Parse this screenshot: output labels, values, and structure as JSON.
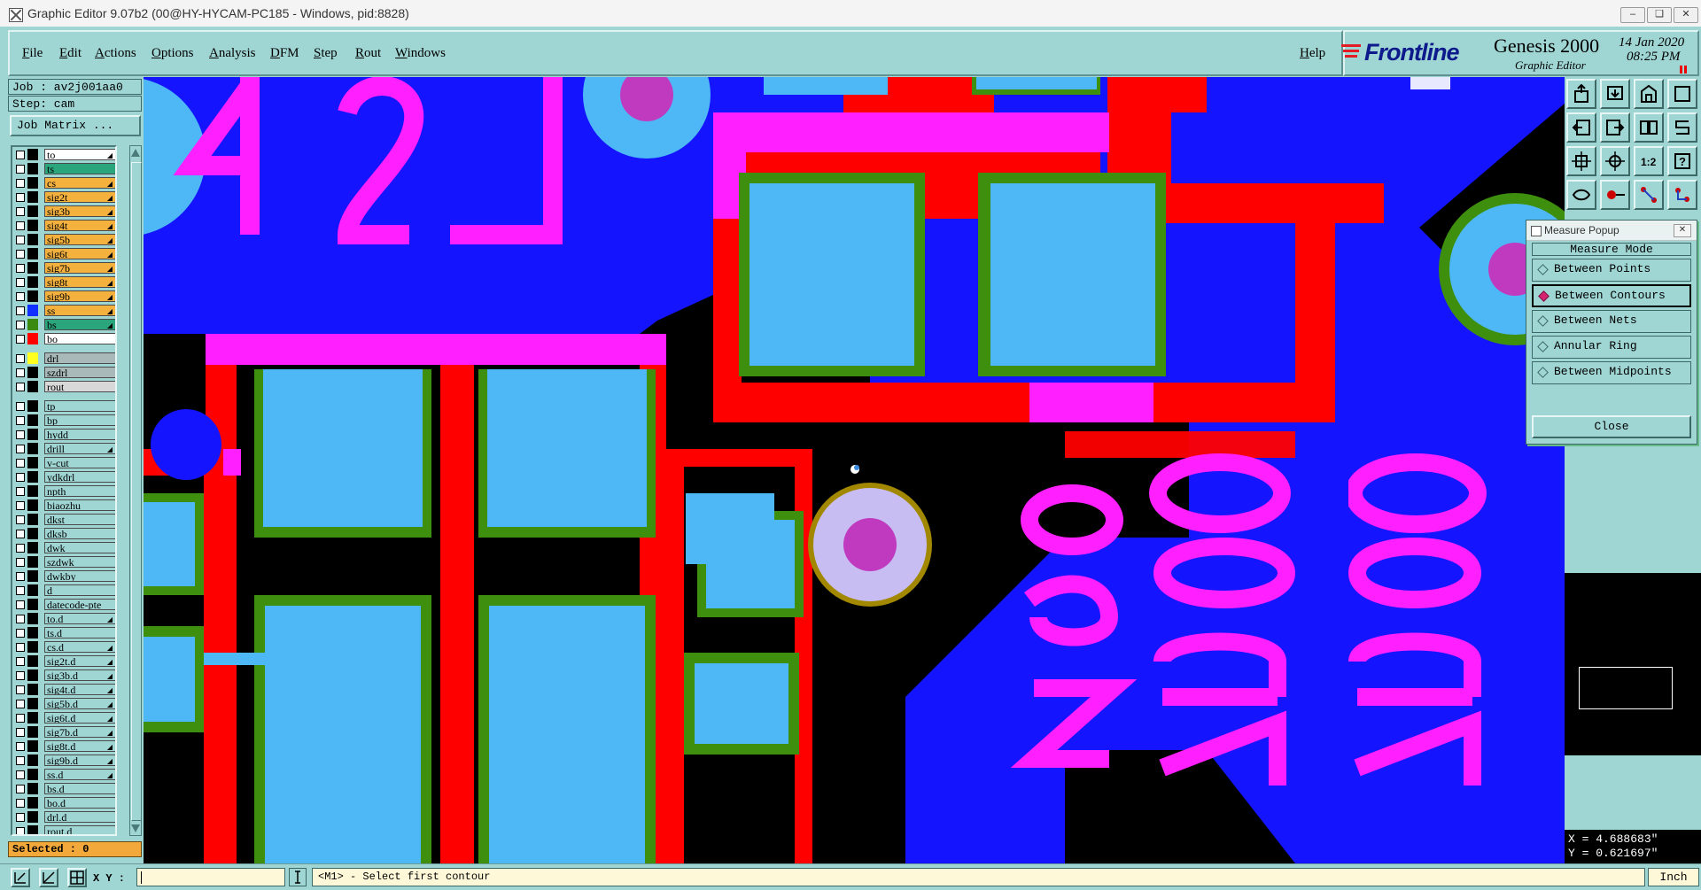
{
  "window": {
    "title": "Graphic Editor 9.07b2 (00@HY-HYCAM-PC185 - Windows, pid:8828)"
  },
  "menu": {
    "items": [
      "File",
      "Edit",
      "Actions",
      "Options",
      "Analysis",
      "DFM",
      "Step",
      "Rout",
      "Windows"
    ],
    "help": "Help"
  },
  "brand": {
    "logo_text": "Frontline",
    "product": "Genesis 2000",
    "subtitle": "Graphic Editor",
    "date": "14 Jan 2020",
    "time": "08:25 PM"
  },
  "left": {
    "job": "Job : av2j001aa0",
    "step": "Step: cam",
    "job_matrix": "Job Matrix ...",
    "selected": "Selected : 0"
  },
  "layers": [
    {
      "name": "to",
      "swatch": "#000000",
      "bg": "#ffffff",
      "arrow": true
    },
    {
      "name": "ts",
      "swatch": "#000000",
      "bg": "#2aa57c",
      "arrow": false
    },
    {
      "name": "cs",
      "swatch": "#000000",
      "bg": "#f5b13e",
      "arrow": true
    },
    {
      "name": "sig2t",
      "swatch": "#000000",
      "bg": "#f5b13e",
      "arrow": true
    },
    {
      "name": "sig3b",
      "swatch": "#000000",
      "bg": "#f5b13e",
      "arrow": true
    },
    {
      "name": "sig4t",
      "swatch": "#000000",
      "bg": "#f5b13e",
      "arrow": true
    },
    {
      "name": "sig5b",
      "swatch": "#000000",
      "bg": "#f5b13e",
      "arrow": true
    },
    {
      "name": "sig6t",
      "swatch": "#000000",
      "bg": "#f5b13e",
      "arrow": true
    },
    {
      "name": "sig7b",
      "swatch": "#000000",
      "bg": "#f5b13e",
      "arrow": true
    },
    {
      "name": "sig8t",
      "swatch": "#000000",
      "bg": "#f5b13e",
      "arrow": true
    },
    {
      "name": "sig9b",
      "swatch": "#000000",
      "bg": "#f5b13e",
      "arrow": true
    },
    {
      "name": "ss",
      "swatch": "#1030ff",
      "bg": "#f5b13e",
      "arrow": true
    },
    {
      "name": "bs",
      "swatch": "#3a8a10",
      "bg": "#2aa57c",
      "arrow": true
    },
    {
      "name": "bo",
      "swatch": "#ff0000",
      "bg": "#ffffff",
      "arrow": false
    },
    {
      "name": "drl",
      "swatch": "#ffff20",
      "bg": "#a9b9b9",
      "arrow": false
    },
    {
      "name": "szdrl",
      "swatch": "#000000",
      "bg": "#a9b9b9",
      "arrow": false
    },
    {
      "name": "rout",
      "swatch": "#000000",
      "bg": "#d8d8d8",
      "arrow": false
    },
    {
      "name": "tp",
      "swatch": "#000000",
      "bg": "#9fd6d4",
      "arrow": false
    },
    {
      "name": "bp",
      "swatch": "#000000",
      "bg": "#9fd6d4",
      "arrow": false
    },
    {
      "name": "hydd",
      "swatch": "#000000",
      "bg": "#9fd6d4",
      "arrow": false
    },
    {
      "name": "drill",
      "swatch": "#000000",
      "bg": "#9fd6d4",
      "arrow": true
    },
    {
      "name": "v-cut",
      "swatch": "#000000",
      "bg": "#9fd6d4",
      "arrow": false
    },
    {
      "name": "ydkdrl",
      "swatch": "#000000",
      "bg": "#9fd6d4",
      "arrow": false
    },
    {
      "name": "npth",
      "swatch": "#000000",
      "bg": "#9fd6d4",
      "arrow": false
    },
    {
      "name": "biaozhu",
      "swatch": "#000000",
      "bg": "#9fd6d4",
      "arrow": false
    },
    {
      "name": "dkst",
      "swatch": "#000000",
      "bg": "#9fd6d4",
      "arrow": false
    },
    {
      "name": "dksb",
      "swatch": "#000000",
      "bg": "#9fd6d4",
      "arrow": false
    },
    {
      "name": "dwk",
      "swatch": "#000000",
      "bg": "#9fd6d4",
      "arrow": false
    },
    {
      "name": "szdwk",
      "swatch": "#000000",
      "bg": "#9fd6d4",
      "arrow": false
    },
    {
      "name": "dwkby",
      "swatch": "#000000",
      "bg": "#9fd6d4",
      "arrow": false
    },
    {
      "name": "d",
      "swatch": "#000000",
      "bg": "#9fd6d4",
      "arrow": false
    },
    {
      "name": "datecode-pte",
      "swatch": "#000000",
      "bg": "#9fd6d4",
      "arrow": false
    },
    {
      "name": "to.d",
      "swatch": "#000000",
      "bg": "#9fd6d4",
      "arrow": true
    },
    {
      "name": "ts.d",
      "swatch": "#000000",
      "bg": "#9fd6d4",
      "arrow": false
    },
    {
      "name": "cs.d",
      "swatch": "#000000",
      "bg": "#9fd6d4",
      "arrow": true
    },
    {
      "name": "sig2t.d",
      "swatch": "#000000",
      "bg": "#9fd6d4",
      "arrow": true
    },
    {
      "name": "sig3b.d",
      "swatch": "#000000",
      "bg": "#9fd6d4",
      "arrow": true
    },
    {
      "name": "sig4t.d",
      "swatch": "#000000",
      "bg": "#9fd6d4",
      "arrow": true
    },
    {
      "name": "sig5b.d",
      "swatch": "#000000",
      "bg": "#9fd6d4",
      "arrow": true
    },
    {
      "name": "sig6t.d",
      "swatch": "#000000",
      "bg": "#9fd6d4",
      "arrow": true
    },
    {
      "name": "sig7b.d",
      "swatch": "#000000",
      "bg": "#9fd6d4",
      "arrow": true
    },
    {
      "name": "sig8t.d",
      "swatch": "#000000",
      "bg": "#9fd6d4",
      "arrow": true
    },
    {
      "name": "sig9b.d",
      "swatch": "#000000",
      "bg": "#9fd6d4",
      "arrow": true
    },
    {
      "name": "ss.d",
      "swatch": "#000000",
      "bg": "#9fd6d4",
      "arrow": true
    },
    {
      "name": "bs.d",
      "swatch": "#000000",
      "bg": "#9fd6d4",
      "arrow": false
    },
    {
      "name": "bo.d",
      "swatch": "#000000",
      "bg": "#9fd6d4",
      "arrow": false
    },
    {
      "name": "drl.d",
      "swatch": "#000000",
      "bg": "#9fd6d4",
      "arrow": false
    },
    {
      "name": "rout.d",
      "swatch": "#000000",
      "bg": "#9fd6d4",
      "arrow": false
    }
  ],
  "canvas": {
    "silkscreen_top": "L24",
    "silkscreen_bottom_cols": [
      "8",
      "9",
      "6",
      "2",
      "5",
      "5"
    ],
    "silk_text_a": "2528",
    "silk_text_b": "2529",
    "silk_text_c": "2560"
  },
  "measure_popup": {
    "title": "Measure Popup",
    "heading": "Measure Mode",
    "options": [
      "Between Points",
      "Between Contours",
      "Between Nets",
      "Annular Ring",
      "Between Midpoints"
    ],
    "selected": "Between Contours",
    "close": "Close"
  },
  "coords": {
    "x": "X = 4.688683\"",
    "y": "Y = 0.621697\""
  },
  "status": {
    "xy_label": "X Y :",
    "prompt": "<M1> - Select first contour",
    "unit": "Inch"
  },
  "colors": {
    "panel": "#9fd6d4",
    "copper_blue": "#1414ff",
    "soldermask_light": "#4db8f5",
    "red": "#ff0000",
    "magenta": "#ff1fff",
    "green": "#3f8f0f"
  }
}
